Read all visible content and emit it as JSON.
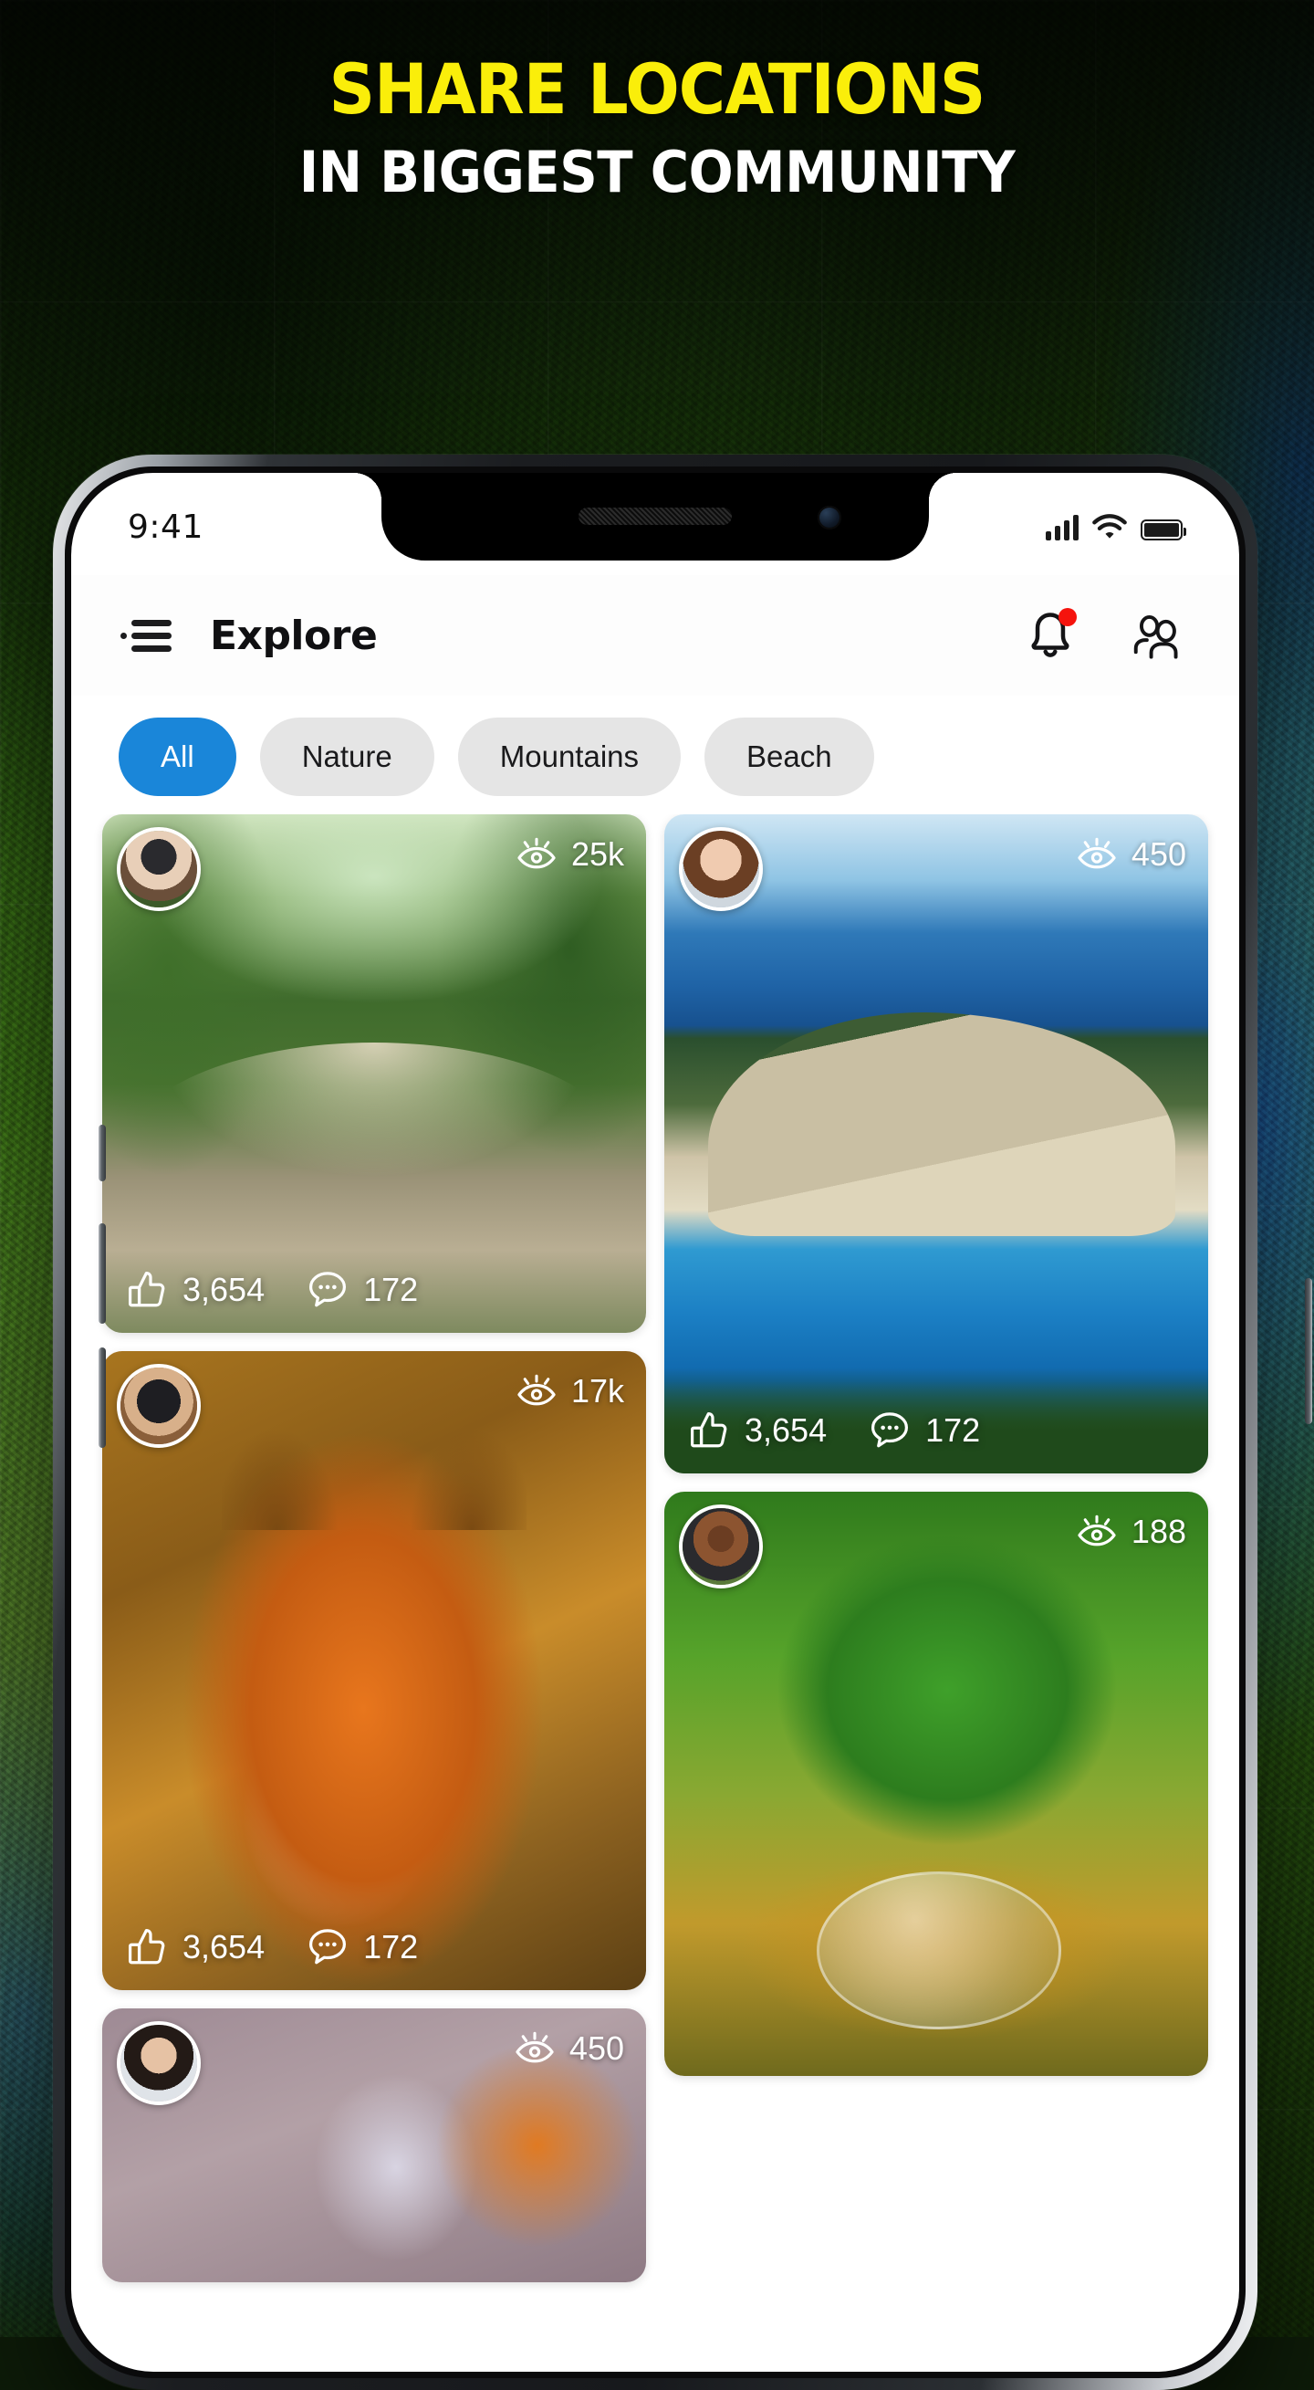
{
  "promo": {
    "headline_line1": "SHARE LOCATIONS",
    "headline_line2": "IN BIGGEST COMMUNITY",
    "headline_color": "#FAEE0A",
    "subhead_color": "#FFFFFF"
  },
  "status_bar": {
    "time": "9:41",
    "signal_icon": "cellular-signal-icon",
    "wifi_icon": "wifi-icon",
    "battery_icon": "battery-full-icon"
  },
  "header": {
    "menu_icon": "hamburger-menu-icon",
    "title": "Explore",
    "notifications_icon": "bell-icon",
    "notification_badge": true,
    "friends_icon": "people-icon",
    "badge_color": "#F5130D"
  },
  "filters": {
    "active_color": "#1A86D9",
    "inactive_color": "#E5E5E5",
    "chips": [
      {
        "label": "All",
        "active": true
      },
      {
        "label": "Nature",
        "active": false
      },
      {
        "label": "Mountains",
        "active": false
      },
      {
        "label": "Beach",
        "active": false
      }
    ]
  },
  "feed": {
    "icons": {
      "views": "eye-icon",
      "likes": "thumbs-up-icon",
      "comments": "comment-bubble-icon"
    },
    "left_column": [
      {
        "photo": "wooden-bridge-in-green-park",
        "avatar": "woman-with-hat-avatar",
        "views": "25k",
        "likes": "3,654",
        "comments": "172"
      },
      {
        "photo": "red-fox-portrait",
        "avatar": "person-with-binoculars-avatar",
        "views": "17k",
        "likes": "3,654",
        "comments": "172"
      },
      {
        "photo": "orange-berries-still-life",
        "avatar": "young-man-avatar",
        "views": "450",
        "likes": "",
        "comments": ""
      }
    ],
    "right_column": [
      {
        "photo": "navagio-beach-cliff-blue-sea",
        "avatar": "woman-portrait-avatar",
        "views": "450",
        "likes": "3,654",
        "comments": "172"
      },
      {
        "photo": "tree-in-glass-globe-terrarium",
        "avatar": "smiling-woman-avatar",
        "views": "188",
        "likes": "",
        "comments": ""
      }
    ]
  }
}
